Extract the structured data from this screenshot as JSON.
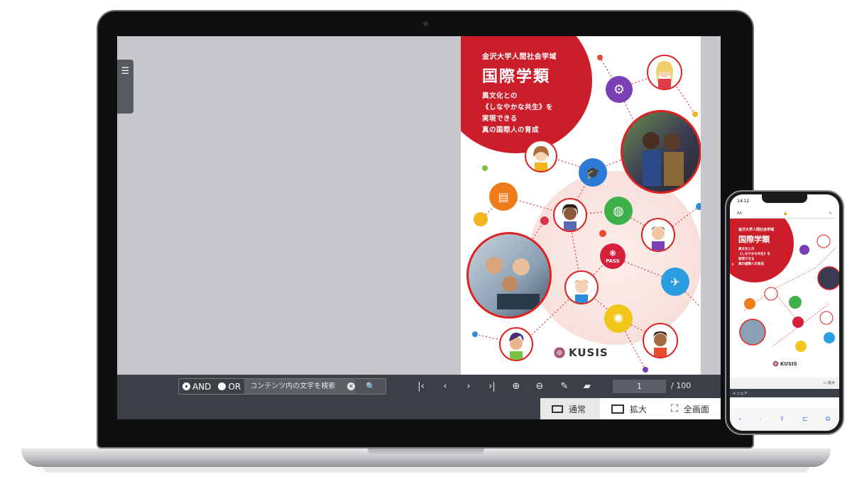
{
  "brochure": {
    "university": "金沢大学人間社会学域",
    "department": "国際学類",
    "tagline": [
      "異文化との",
      "《しなやかな共生》を",
      "実現できる",
      "真の国際人の育成"
    ],
    "logo_text": "KUSIS",
    "passport_label": "PASS"
  },
  "toolbar": {
    "and_label": "AND",
    "or_label": "OR",
    "search_placeholder": "コンテンツ内の文字を検索",
    "page_current": "1",
    "page_total": "/ 100",
    "icons": [
      "first-page-icon",
      "prev-page-icon",
      "next-page-icon",
      "last-page-icon",
      "zoom-in-icon",
      "zoom-out-icon",
      "pen-icon",
      "eraser-icon"
    ]
  },
  "view_modes": {
    "normal": "通常",
    "zoom": "拡大",
    "fullscreen": "全画面"
  },
  "phone": {
    "time": "14:12",
    "url_left": "AA",
    "share_label": "シェア",
    "zoom_label": "拡大",
    "university": "金沢大学人間社会学域",
    "department": "国際学類",
    "tagline": [
      "異文化との",
      "《しなやかな共生》を",
      "実現できる",
      "真の国際人の育成"
    ],
    "logo_text": "KUSIS"
  },
  "colors": {
    "accent_red": "#cc1e2a",
    "toolbar_bg": "#3b4047",
    "viewer_bg": "#c6c6cb"
  }
}
